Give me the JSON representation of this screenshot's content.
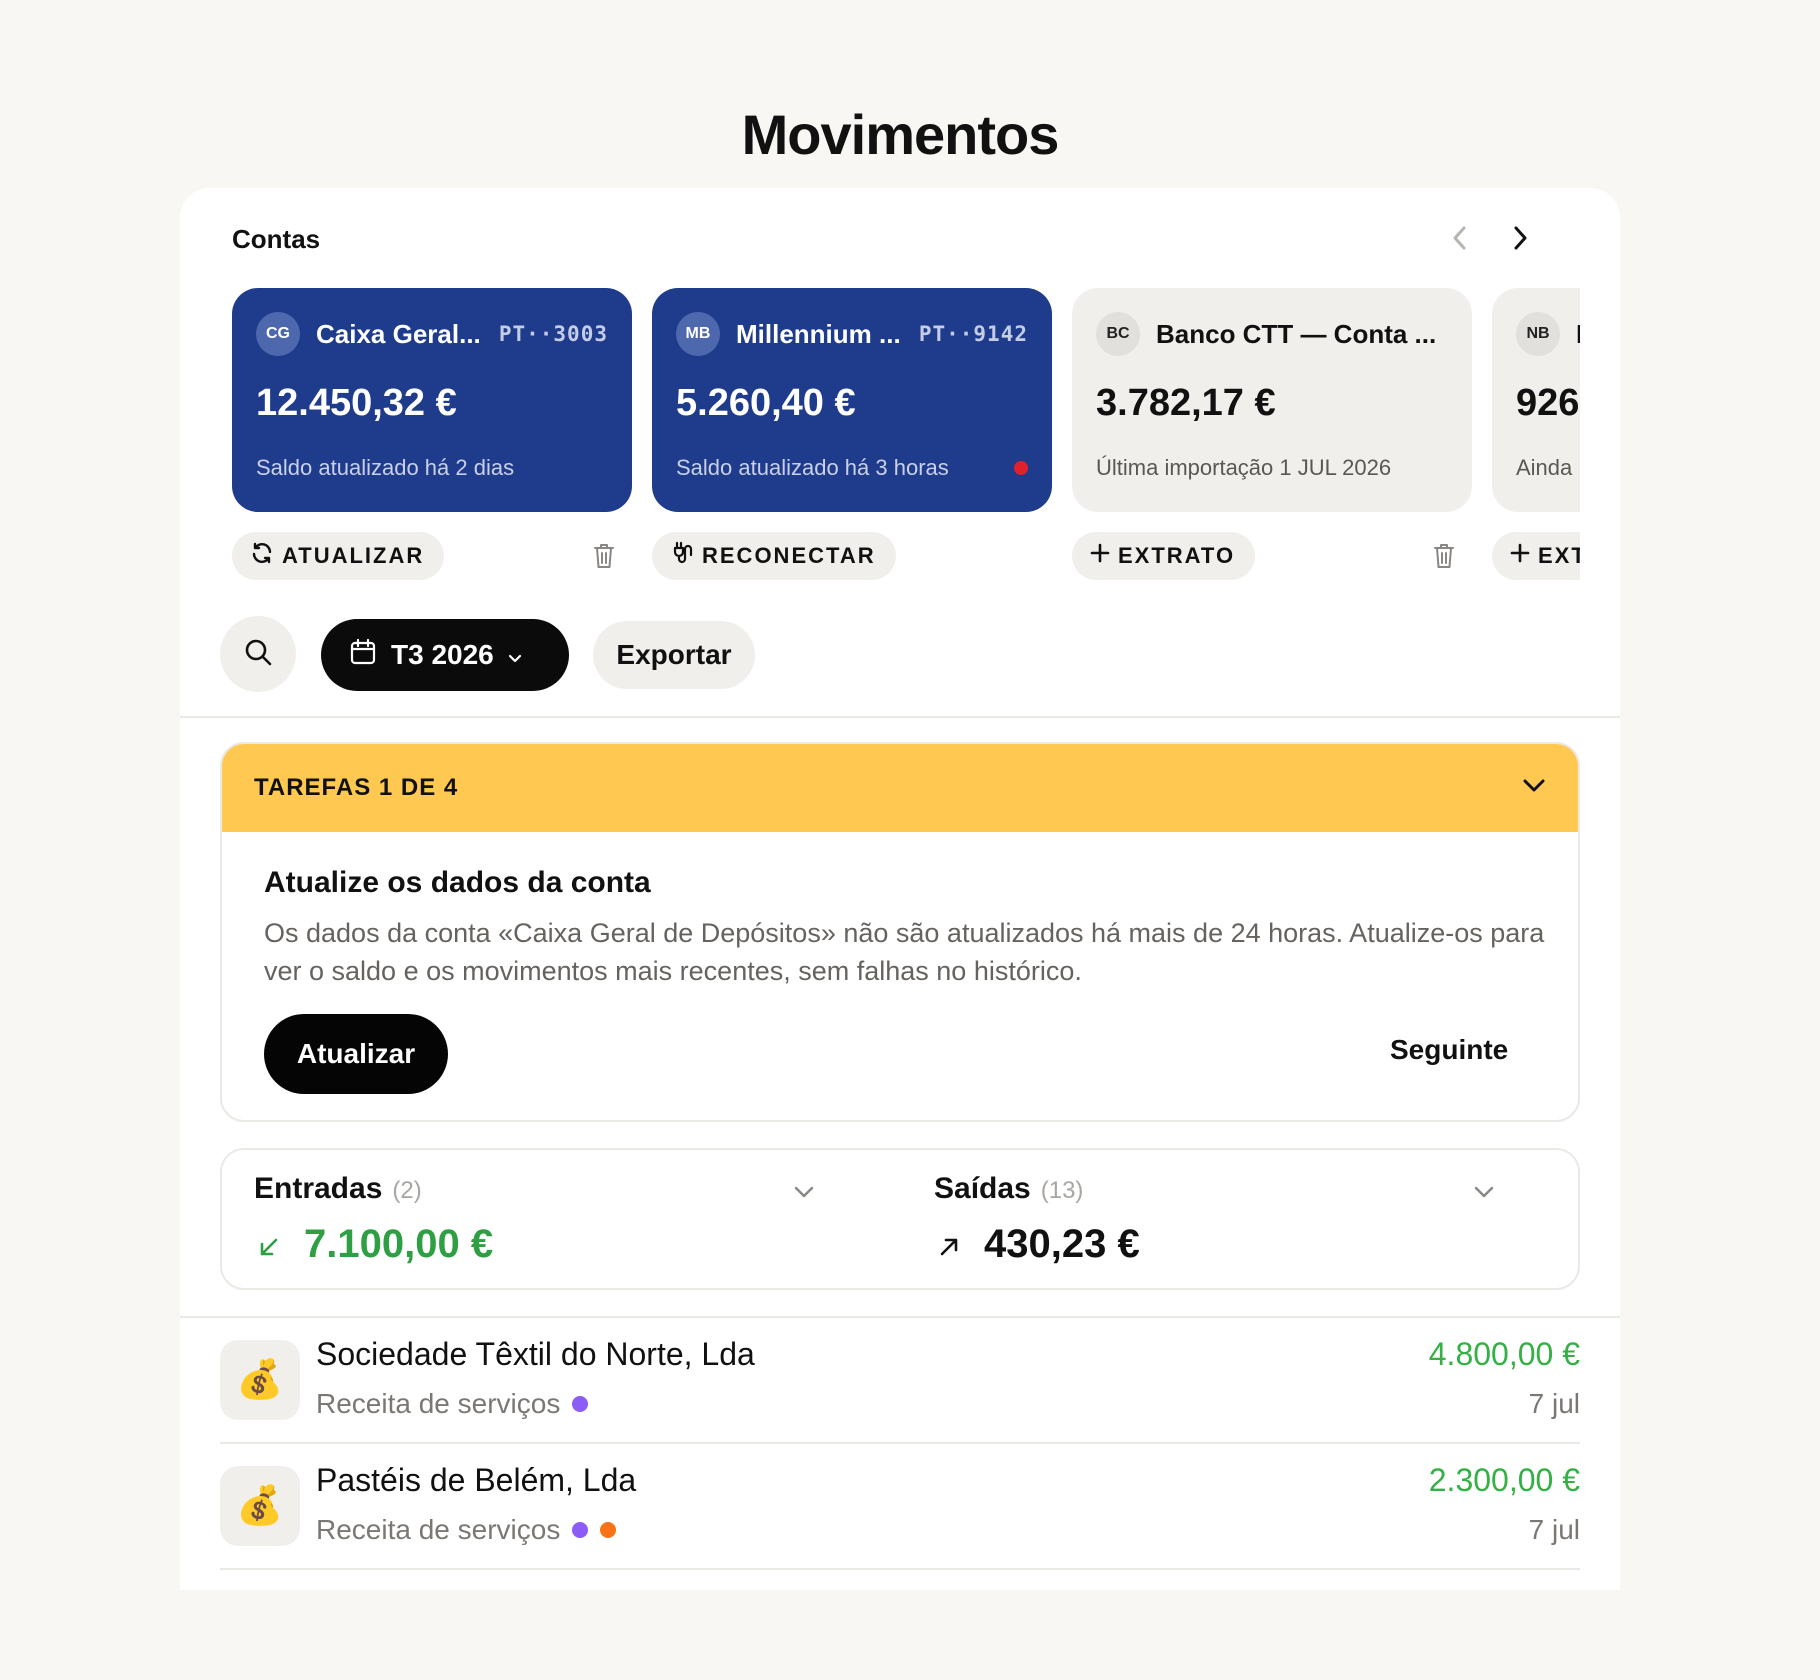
{
  "page": {
    "title": "Movimentos"
  },
  "accounts": {
    "label": "Contas",
    "cards": [
      {
        "initials": "CG",
        "name": "Caixa Geral...",
        "iban": "PT··3003",
        "balance": "12.450,32 €",
        "status": "Saldo atualizado há 2 dias",
        "style": "blue",
        "action": "ATUALIZAR",
        "action_icon": "refresh-icon",
        "has_delete": true
      },
      {
        "initials": "MB",
        "name": "Millennium ...",
        "iban": "PT··9142",
        "balance": "5.260,40 €",
        "status": "Saldo atualizado há 3 horas",
        "style": "blue",
        "alert": true,
        "action": "RECONECTAR",
        "action_icon": "plug-icon",
        "has_delete": false
      },
      {
        "initials": "BC",
        "name": "Banco CTT — Conta ...",
        "balance": "3.782,17 €",
        "status": "Última importação 1 JUL 2026",
        "style": "light",
        "action": "EXTRATO",
        "action_icon": "plus-icon",
        "has_delete": true
      },
      {
        "initials": "NB",
        "name": "I",
        "balance": "926",
        "status": "Ainda",
        "style": "light",
        "action": "EXT",
        "action_icon": "plus-icon",
        "has_delete": false
      }
    ]
  },
  "toolbar": {
    "period": "T3 2026",
    "export": "Exportar"
  },
  "tasks": {
    "header": "TAREFAS 1 DE 4",
    "title": "Atualize os dados da conta",
    "description": "Os dados da conta «Caixa Geral de Depósitos» não são atualizados há mais de 24 horas. Atualize-os para ver o saldo e os movimentos mais recentes, sem falhas no histórico.",
    "primary": "Atualizar",
    "secondary": "Seguinte"
  },
  "summary": {
    "income": {
      "label": "Entradas",
      "count": "(2)",
      "amount": "7.100,00 €",
      "color": "#2ea043"
    },
    "expenses": {
      "label": "Saídas",
      "count": "(13)",
      "amount": "430,23 €",
      "color": "#111111"
    }
  },
  "transactions": [
    {
      "icon": "💰",
      "name": "Sociedade Têxtil do Norte, Lda",
      "category": "Receita de serviços",
      "dots": [
        "#8b5cf6"
      ],
      "amount": "4.800,00 €",
      "date": "7 jul"
    },
    {
      "icon": "💰",
      "name": "Pastéis de Belém, Lda",
      "category": "Receita de serviços",
      "dots": [
        "#8b5cf6",
        "#f97316"
      ],
      "amount": "2.300,00 €",
      "date": "7 jul"
    }
  ]
}
